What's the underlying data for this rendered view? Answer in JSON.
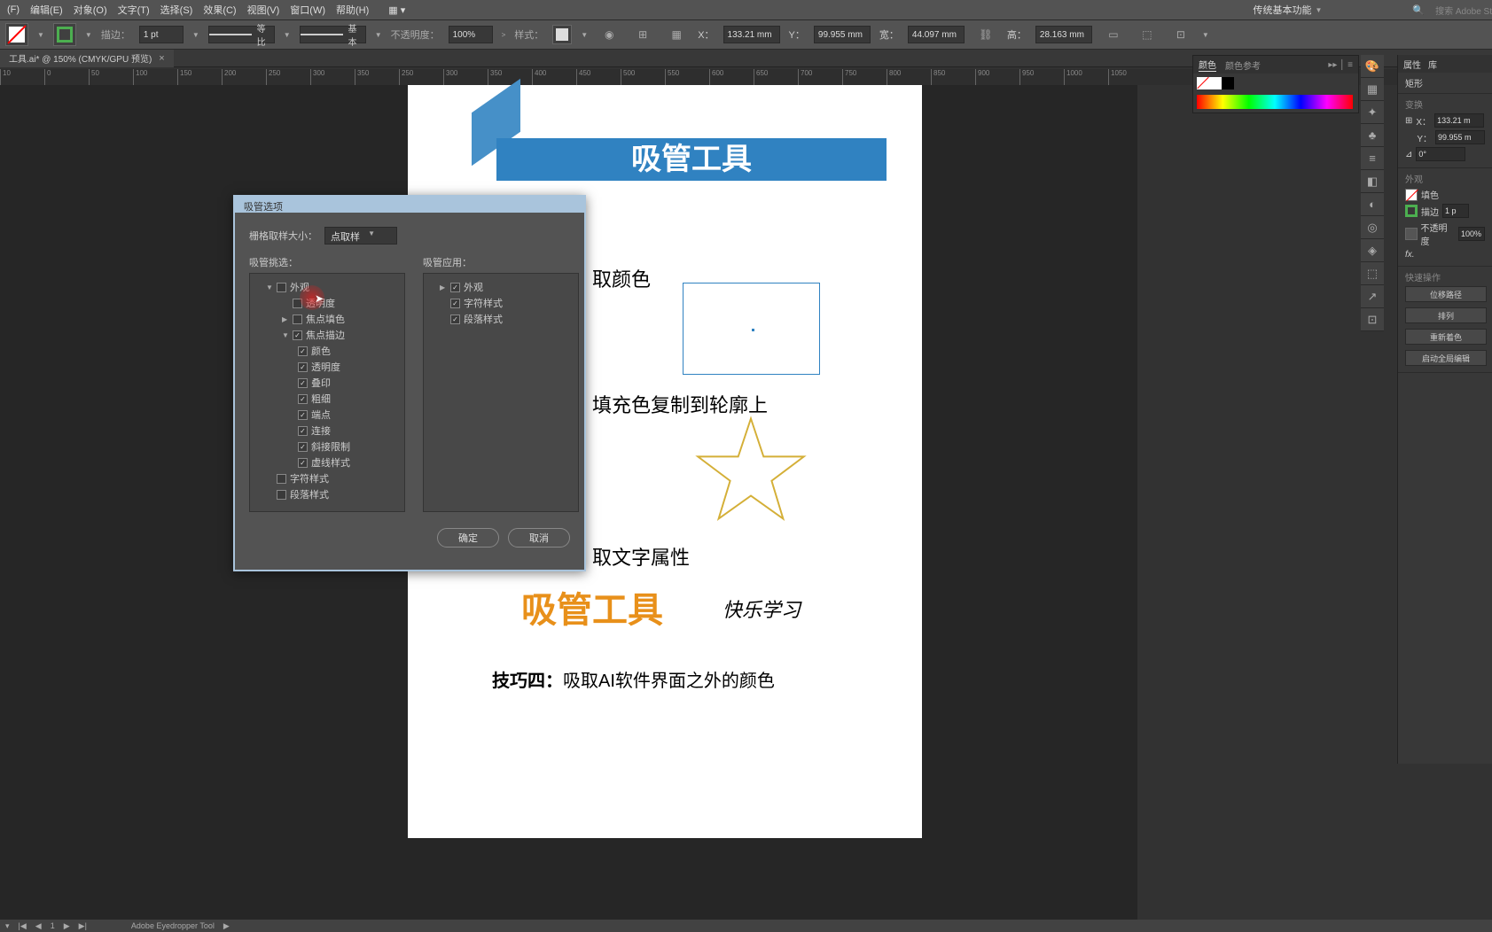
{
  "menu": {
    "file": "(F)",
    "edit": "编辑(E)",
    "object": "对象(O)",
    "type": "文字(T)",
    "select": "选择(S)",
    "effect": "效果(C)",
    "view": "视图(V)",
    "window": "窗口(W)",
    "help": "帮助(H)"
  },
  "workspace": "传统基本功能",
  "search": "搜索 Adobe St",
  "control": {
    "stroke_label": "描边：",
    "stroke_val": "1 pt",
    "stroke_opt1": "等比",
    "stroke_opt2": "基本",
    "opacity_label": "不透明度：",
    "opacity_val": "100%",
    "style_label": "样式：",
    "x_label": "X：",
    "x_val": "133.21 mm",
    "y_label": "Y：",
    "y_val": "99.955 mm",
    "w_label": "宽：",
    "w_val": "44.097 mm",
    "h_label": "高：",
    "h_val": "28.163 mm"
  },
  "doc_tab": "工具.ai* @ 150% (CMYK/GPU 预览)",
  "ruler_ticks": [
    "10",
    "0",
    "50",
    "100",
    "150",
    "200",
    "250",
    "300",
    "350",
    "250",
    "300",
    "350",
    "400",
    "450",
    "500",
    "550",
    "600",
    "650",
    "700",
    "750",
    "800",
    "850",
    "900",
    "950",
    "1000",
    "1050"
  ],
  "artboard": {
    "title": "吸管工具",
    "section1": "取颜色",
    "section2": "填充色复制到轮廓上",
    "section3": "取文字属性",
    "bigtext": "吸管工具",
    "subtext": "快乐学习",
    "tip_bold": "技巧四：",
    "tip_rest": "吸取AI软件界面之外的颜色"
  },
  "dialog": {
    "title": "吸管选项",
    "sample_label": "栅格取样大小：",
    "sample_val": "点取样",
    "col1_header": "吸管挑选：",
    "col2_header": "吸管应用：",
    "tree_pick": {
      "appearance": "外观",
      "transparency": "透明度",
      "focal_fill": "焦点填色",
      "focal_stroke": "焦点描边",
      "color": "颜色",
      "transp2": "透明度",
      "overprint": "叠印",
      "weight": "粗细",
      "cap": "端点",
      "join": "连接",
      "miter": "斜接限制",
      "dash": "虚线样式",
      "char": "字符样式",
      "para": "段落样式"
    },
    "tree_apply": {
      "appearance": "外观",
      "char": "字符样式",
      "para": "段落样式"
    },
    "ok": "确定",
    "cancel": "取消"
  },
  "panel_color": {
    "tab1": "颜色",
    "tab2": "颜色参考"
  },
  "panel_props": {
    "tab1": "属性",
    "tab2": "库",
    "shape": "矩形",
    "transform": "变换",
    "x": "X：",
    "x_val": "133.21 m",
    "y": "Y：",
    "y_val": "99.955 m",
    "rot": "0°",
    "appearance": "外观",
    "fill": "填色",
    "stroke": "描边",
    "stroke_val": "1 p",
    "opacity": "不透明度",
    "opacity_val": "100%",
    "fx": "fx.",
    "quick": "快速操作",
    "btn1": "位移路径",
    "btn2": "排列",
    "btn3": "重新着色",
    "btn4": "启动全局编辑"
  },
  "status": {
    "page": "1",
    "tool": "Adobe Eyedropper Tool"
  }
}
